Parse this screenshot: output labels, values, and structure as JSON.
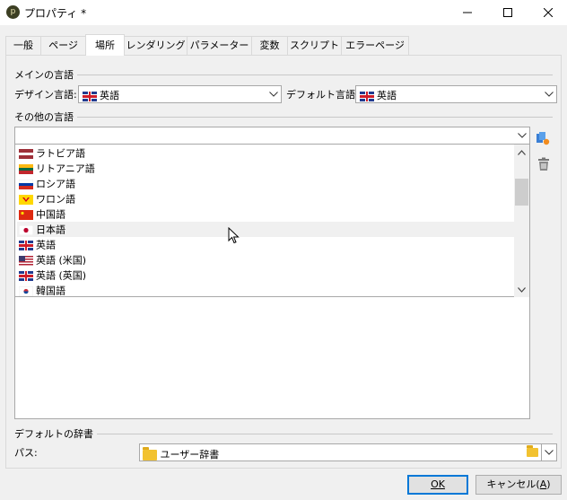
{
  "window": {
    "title": "プロパティ *",
    "app_icon_glyph": "p"
  },
  "tabs": [
    {
      "label": "一般"
    },
    {
      "label": "ページ"
    },
    {
      "label": "場所"
    },
    {
      "label": "レンダリング"
    },
    {
      "label": "パラメーター"
    },
    {
      "label": "変数"
    },
    {
      "label": "スクリプト"
    },
    {
      "label": "エラーページ"
    }
  ],
  "main_lang": {
    "section": "メインの言語",
    "design_label": "デザイン言語:",
    "design_value": "英語",
    "default_label": "デフォルト言語:",
    "default_value": "英語"
  },
  "other_lang": {
    "section": "その他の言語",
    "input_value": "",
    "items": [
      {
        "label": "ラトビア語",
        "flag": "latvia"
      },
      {
        "label": "リトアニア語",
        "flag": "lithuania"
      },
      {
        "label": "ロシア語",
        "flag": "russia"
      },
      {
        "label": "ワロン語",
        "flag": "wallonia"
      },
      {
        "label": "中国語",
        "flag": "china"
      },
      {
        "label": "日本語",
        "flag": "japan"
      },
      {
        "label": "英語",
        "flag": "uk"
      },
      {
        "label": "英語 (米国)",
        "flag": "usa"
      },
      {
        "label": "英語 (英国)",
        "flag": "uk"
      },
      {
        "label": "韓国語",
        "flag": "korea"
      }
    ]
  },
  "dictionary": {
    "section": "デフォルトの辞書",
    "path_label": "パス:",
    "path_value": "ユーザー辞書"
  },
  "buttons": {
    "ok": "OK",
    "cancel_text": "キャンセル(",
    "cancel_key": "A",
    "cancel_close": ")"
  },
  "colors": {
    "focus_border": "#0078d7",
    "hover_row": "#f0f0f0"
  }
}
